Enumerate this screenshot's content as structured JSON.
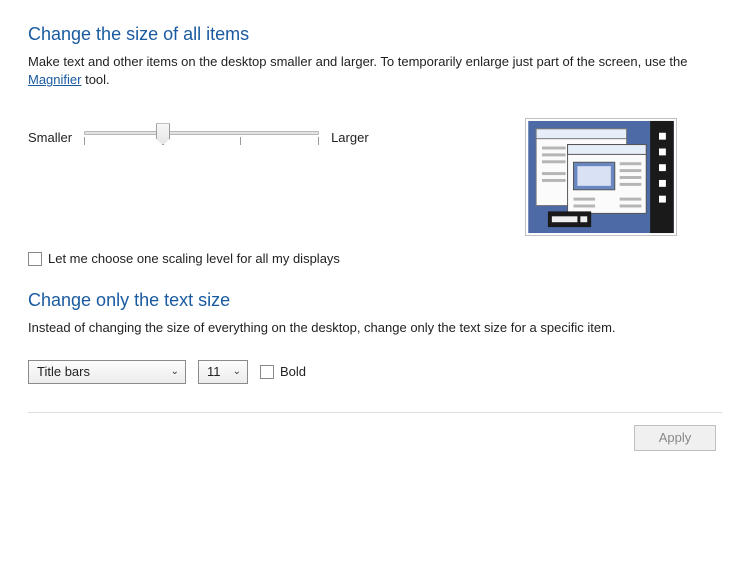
{
  "section1": {
    "heading": "Change the size of all items",
    "desc_prefix": "Make text and other items on the desktop smaller and larger. To temporarily enlarge just part of the screen, use the ",
    "magnifier_link": "Magnifier",
    "desc_suffix": " tool.",
    "slider_left_label": "Smaller",
    "slider_right_label": "Larger",
    "scaling_checkbox_label": "Let me choose one scaling level for all my displays",
    "scaling_checked": false
  },
  "section2": {
    "heading": "Change only the text size",
    "desc": "Instead of changing the size of everything on the desktop, change only the text size for a specific item.",
    "item_select_value": "Title bars",
    "size_select_value": "11",
    "bold_label": "Bold",
    "bold_checked": false
  },
  "footer": {
    "apply_label": "Apply"
  }
}
